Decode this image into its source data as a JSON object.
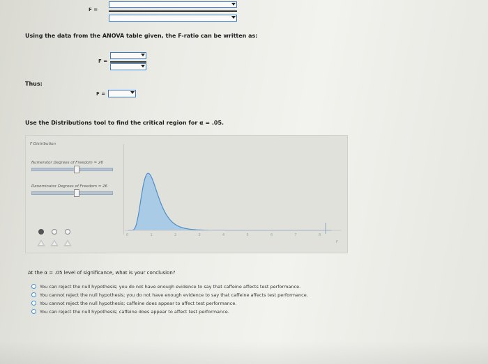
{
  "top": {
    "f_label": "F ="
  },
  "question1": {
    "text": "Using the data from the ANOVA table given, the F-ratio can be written as:",
    "f_label": "F ="
  },
  "thus": {
    "label": "Thus:",
    "f_label": "F ="
  },
  "instruction": {
    "text": "Use the Distributions tool to find the critical region for α = .05."
  },
  "tool": {
    "title": "F Distribution",
    "numerator_label": "Numerator Degrees of Freedom = 26",
    "denominator_label": "Denominator Degrees of Freedom = 26",
    "x_ticks": [
      "0",
      "1",
      "2",
      "3",
      "4",
      "5",
      "6",
      "7",
      "8"
    ],
    "x_axis_label": "F"
  },
  "conclusion": {
    "question": "At the α = .05 level of significance, what is your conclusion?",
    "options": [
      "You can reject the null hypothesis; you do not have enough evidence to say that caffeine affects test performance.",
      "You cannot reject the null hypothesis; you do not have enough evidence to say that caffeine affects test performance.",
      "You cannot reject the null hypothesis; caffeine does appear to affect test performance.",
      "You can reject the null hypothesis; caffeine does appear to affect test performance."
    ]
  },
  "colors": {
    "accent": "#3b78c2",
    "curve_fill": "#a9cbe6",
    "curve_stroke": "#4d8ec8"
  }
}
